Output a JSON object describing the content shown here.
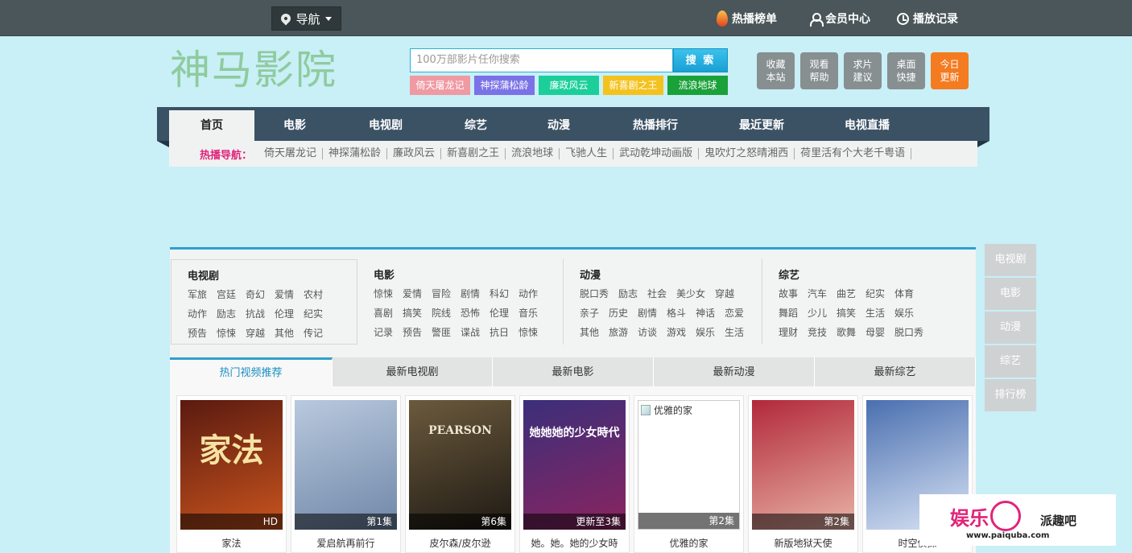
{
  "topbar": {
    "nav_label": "导航",
    "links": [
      "热播榜单",
      "会员中心",
      "播放记录"
    ]
  },
  "header": {
    "logo": "神马影院",
    "search_placeholder": "100万部影片任你搜索",
    "search_button": "搜 索",
    "tags": [
      {
        "label": "倚天屠龙记",
        "color": "#ef9aa3"
      },
      {
        "label": "神探蒲松龄",
        "color": "#7a72e6"
      },
      {
        "label": "廉政风云",
        "color": "#1ccf9a"
      },
      {
        "label": "新喜剧之王",
        "color": "#f4c21e"
      },
      {
        "label": "流浪地球",
        "color": "#1aa13a"
      }
    ],
    "side_buttons": [
      {
        "l1": "收藏",
        "l2": "本站"
      },
      {
        "l1": "观看",
        "l2": "帮助"
      },
      {
        "l1": "求片",
        "l2": "建议"
      },
      {
        "l1": "桌面",
        "l2": "快捷"
      },
      {
        "l1": "今日",
        "l2": "更新"
      }
    ]
  },
  "nav": {
    "items": [
      "首页",
      "电影",
      "电视剧",
      "综艺",
      "动漫",
      "热播排行",
      "最近更新",
      "电视直播"
    ],
    "hot_label": "热播导航：",
    "hot_items": [
      "倚天屠龙记",
      "神探蒲松龄",
      "廉政风云",
      "新喜剧之王",
      "流浪地球",
      "飞驰人生",
      "武动乾坤动画版",
      "鬼吹灯之怒晴湘西",
      "荷里活有个大老千粤语"
    ]
  },
  "categories": [
    {
      "title": "电视剧",
      "rows": [
        [
          "军旅",
          "宫廷",
          "奇幻",
          "爱情",
          "农村"
        ],
        [
          "动作",
          "励志",
          "抗战",
          "伦理",
          "纪实"
        ],
        [
          "预告",
          "惊悚",
          "穿越",
          "其他",
          "传记"
        ]
      ]
    },
    {
      "title": "电影",
      "rows": [
        [
          "惊悚",
          "爱情",
          "冒险",
          "剧情",
          "科幻",
          "动作"
        ],
        [
          "喜剧",
          "搞笑",
          "院线",
          "恐怖",
          "伦理",
          "音乐"
        ],
        [
          "记录",
          "预告",
          "警匪",
          "谍战",
          "抗日",
          "惊悚"
        ]
      ]
    },
    {
      "title": "动漫",
      "rows": [
        [
          "脱口秀",
          "励志",
          "社会",
          "美少女",
          "穿越"
        ],
        [
          "亲子",
          "历史",
          "剧情",
          "格斗",
          "神话",
          "恋爱"
        ],
        [
          "其他",
          "旅游",
          "访谈",
          "游戏",
          "娱乐",
          "生活"
        ]
      ]
    },
    {
      "title": "综艺",
      "rows": [
        [
          "故事",
          "汽车",
          "曲艺",
          "纪实",
          "体育"
        ],
        [
          "舞蹈",
          "少儿",
          "搞笑",
          "生活",
          "娱乐"
        ],
        [
          "理财",
          "竞技",
          "歌舞",
          "母婴",
          "脱口秀"
        ]
      ]
    }
  ],
  "tabs": [
    "热门视频推荐",
    "最新电视剧",
    "最新电影",
    "最新动漫",
    "最新综艺"
  ],
  "videos": [
    {
      "title": "家法",
      "badge": "HD",
      "poster_text": "家法",
      "bg1": "#5a1a10",
      "bg2": "#c9541e",
      "fg": "#f6e3a3"
    },
    {
      "title": "爱启航再前行",
      "badge": "第1集",
      "poster_text": "",
      "bg1": "#b9c9de",
      "bg2": "#6f87a8",
      "fg": "#ffffff"
    },
    {
      "title": "皮尔森/皮尔逊",
      "badge": "第6集",
      "poster_text": "PEARSON",
      "bg1": "#6b5a3d",
      "bg2": "#1f1a14",
      "fg": "#f0e6d2"
    },
    {
      "title": "她。她。她的少女時",
      "badge": "更新至3集",
      "poster_text": "她她她的少女時代",
      "bg1": "#3b2f7a",
      "bg2": "#8b2460",
      "fg": "#ffffff"
    },
    {
      "title": "优雅的家",
      "badge": "第2集",
      "poster_text": "",
      "broken": "优雅的家"
    },
    {
      "title": "新版地狱天使",
      "badge": "第2集",
      "poster_text": "",
      "bg1": "#b2283a",
      "bg2": "#e8b3a6",
      "fg": "#ffffff"
    },
    {
      "title": "时空侦探",
      "badge": "",
      "poster_text": "",
      "bg1": "#4a6fb0",
      "bg2": "#d8e3f4",
      "fg": "#ffffff"
    }
  ],
  "side_float": [
    "电视剧",
    "电影",
    "动漫",
    "综艺",
    "排行榜"
  ],
  "watermark": {
    "logo": "娱乐",
    "brand": "派趣吧",
    "url": "www.paiquba.com"
  }
}
